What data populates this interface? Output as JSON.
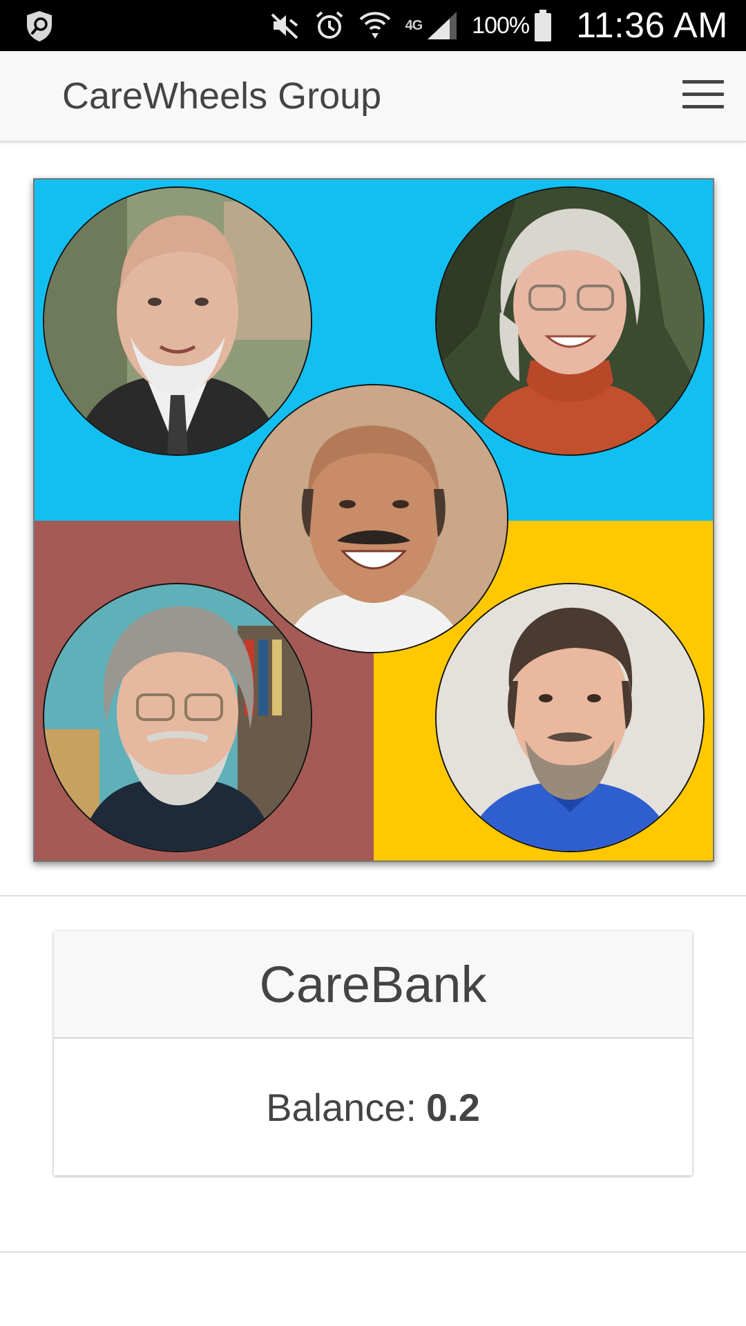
{
  "status_bar": {
    "battery_percent": "100%",
    "network_type": "4G",
    "time": "11:36 AM",
    "icons": [
      "shield-search-icon",
      "mute-icon",
      "alarm-icon",
      "wifi-icon",
      "lte-icon",
      "signal-icon",
      "battery-icon"
    ]
  },
  "app_bar": {
    "title": "CareWheels Group",
    "menu_icon": "hamburger-icon"
  },
  "group": {
    "background_colors": {
      "top": "#12bff0",
      "bottom_left": "#a55a56",
      "bottom_right": "#ffc800"
    },
    "members": [
      {
        "position": "top-left",
        "icon": "member-avatar"
      },
      {
        "position": "top-right",
        "icon": "member-avatar"
      },
      {
        "position": "center",
        "icon": "member-avatar"
      },
      {
        "position": "bottom-left",
        "icon": "member-avatar"
      },
      {
        "position": "bottom-right",
        "icon": "member-avatar"
      }
    ]
  },
  "carebank": {
    "title": "CareBank",
    "balance_label": "Balance:",
    "balance_value": "0.2"
  }
}
